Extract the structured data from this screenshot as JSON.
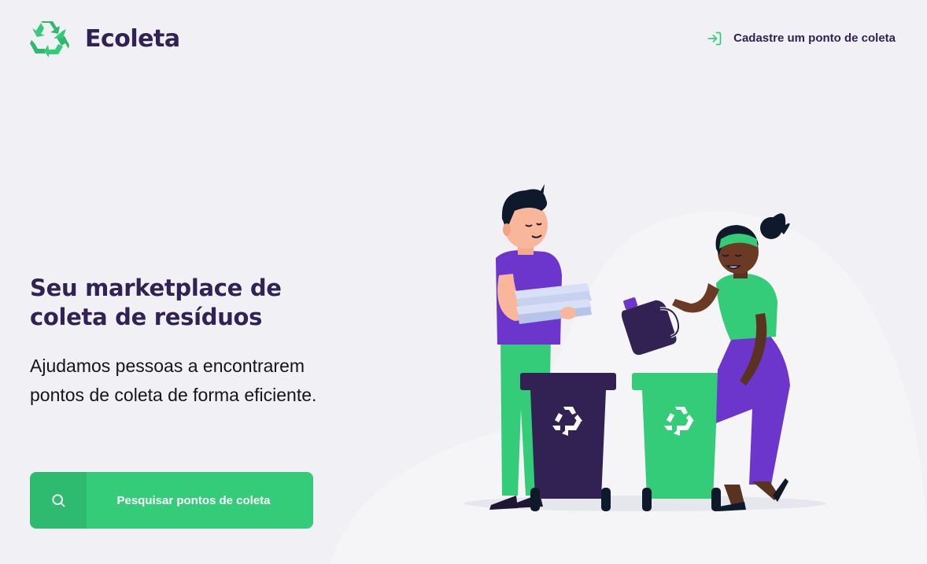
{
  "app": {
    "name": "Ecoleta",
    "logo_icon": "recycle-logo-icon"
  },
  "header": {
    "register_link": {
      "label": "Cadastre um ponto de coleta",
      "icon": "log-in-icon"
    }
  },
  "hero": {
    "title": "Seu marketplace de coleta de resíduos",
    "description": "Ajudamos pessoas a encontrarem pontos de coleta de forma eficiente.",
    "cta": {
      "label": "Pesquisar pontos de coleta",
      "icon": "search-icon"
    }
  },
  "colors": {
    "background": "#F0F0F5",
    "brand_dark": "#322153",
    "brand_green": "#34CB79",
    "text": "#161616",
    "purple": "#6C35CC",
    "bin_dark": "#322153"
  }
}
